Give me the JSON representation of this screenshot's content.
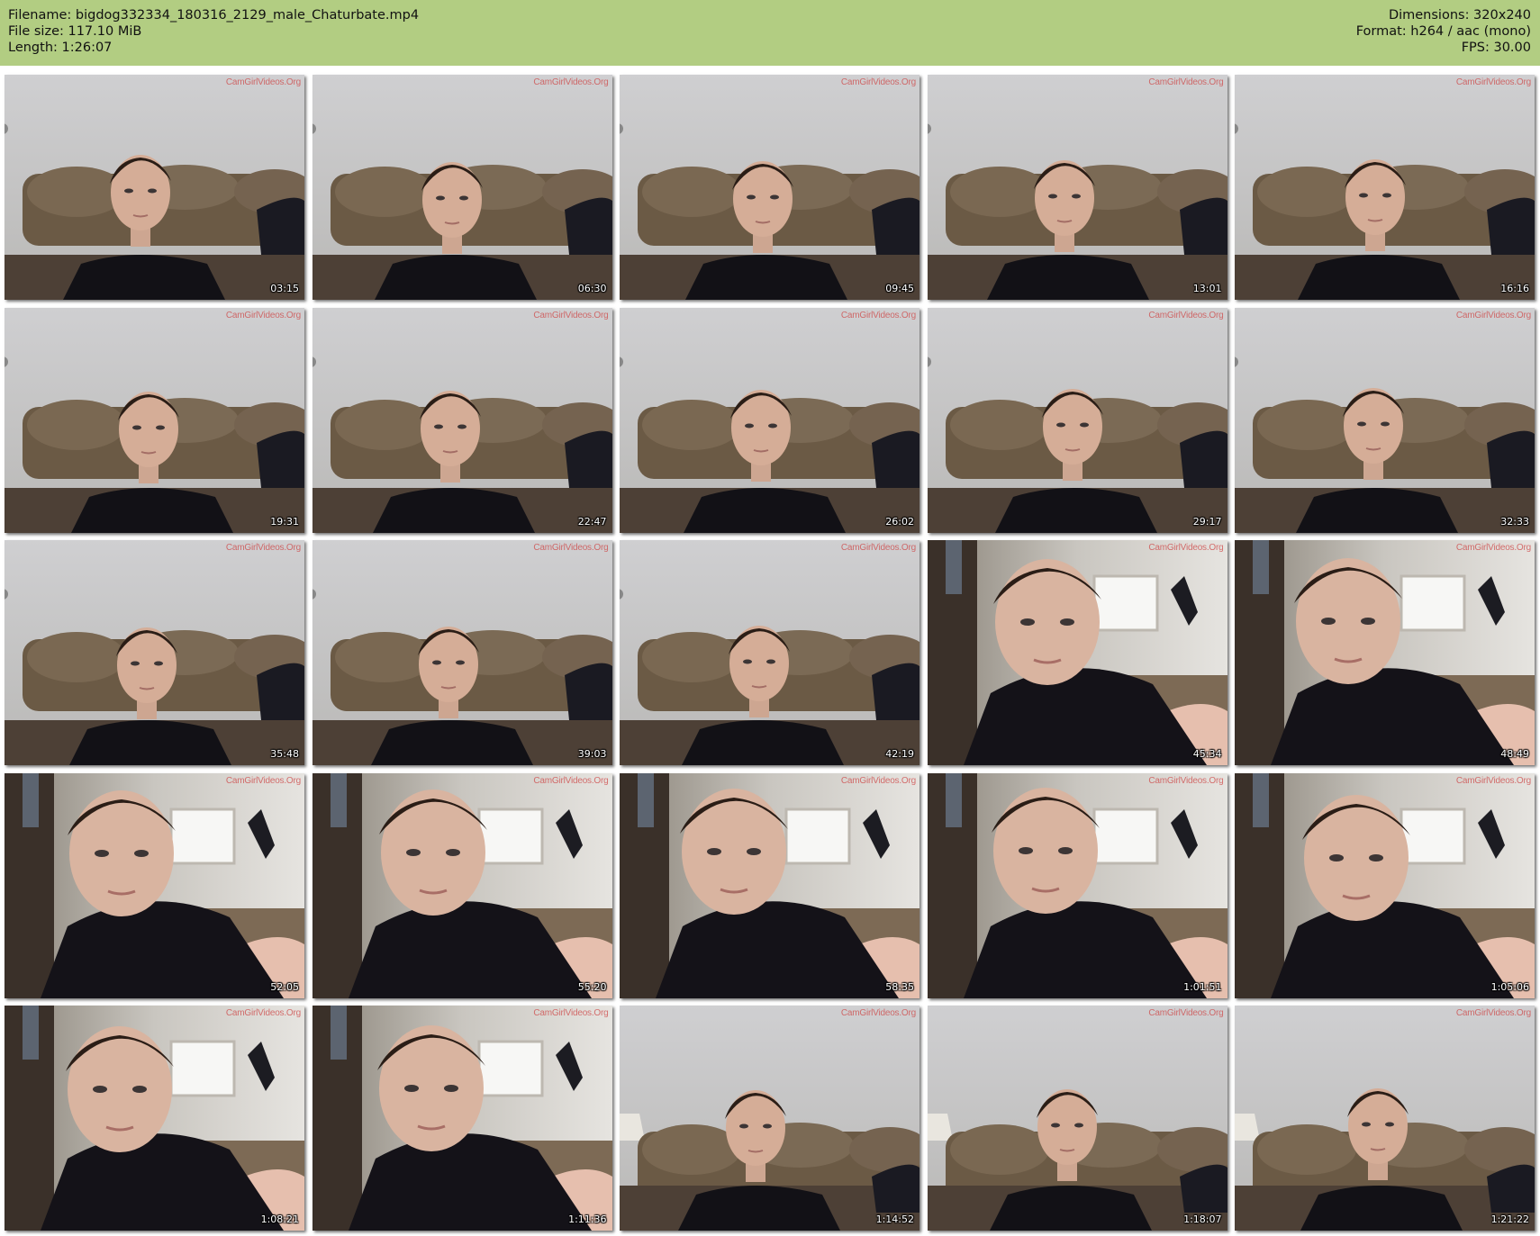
{
  "header": {
    "filename": "Filename: bigdog332334_180316_2129_male_Chaturbate.mp4",
    "filesize": "File size: 117.10 MiB",
    "length": "Length: 1:26:07",
    "dimensions": "Dimensions: 320x240",
    "format": "Format: h264 / aac (mono)",
    "fps": "FPS: 30.00"
  },
  "colors": {
    "header_bg": "#b2cd82",
    "watermark": "#cd4646"
  },
  "thumbnails": [
    {
      "time": "03:15",
      "scene": "couch",
      "watermark": "CamGirlVideos.Org"
    },
    {
      "time": "06:30",
      "scene": "couch",
      "watermark": "CamGirlVideos.Org"
    },
    {
      "time": "09:45",
      "scene": "couch",
      "watermark": "CamGirlVideos.Org"
    },
    {
      "time": "13:01",
      "scene": "couch",
      "watermark": "CamGirlVideos.Org"
    },
    {
      "time": "16:16",
      "scene": "couch",
      "watermark": "CamGirlVideos.Org"
    },
    {
      "time": "19:31",
      "scene": "couch",
      "watermark": "CamGirlVideos.Org"
    },
    {
      "time": "22:47",
      "scene": "couch",
      "watermark": "CamGirlVideos.Org"
    },
    {
      "time": "26:02",
      "scene": "couch",
      "watermark": "CamGirlVideos.Org"
    },
    {
      "time": "29:17",
      "scene": "couch",
      "watermark": "CamGirlVideos.Org"
    },
    {
      "time": "32:33",
      "scene": "couch",
      "watermark": "CamGirlVideos.Org"
    },
    {
      "time": "35:48",
      "scene": "couch",
      "watermark": "CamGirlVideos.Org"
    },
    {
      "time": "39:03",
      "scene": "couch",
      "watermark": "CamGirlVideos.Org"
    },
    {
      "time": "42:19",
      "scene": "couch",
      "watermark": "CamGirlVideos.Org"
    },
    {
      "time": "45:34",
      "scene": "closeup",
      "watermark": "CamGirlVideos.Org"
    },
    {
      "time": "48:49",
      "scene": "closeup",
      "watermark": "CamGirlVideos.Org"
    },
    {
      "time": "52:05",
      "scene": "closeup",
      "watermark": "CamGirlVideos.Org"
    },
    {
      "time": "55:20",
      "scene": "closeup",
      "watermark": "CamGirlVideos.Org"
    },
    {
      "time": "58:35",
      "scene": "closeup",
      "watermark": "CamGirlVideos.Org"
    },
    {
      "time": "1:01:51",
      "scene": "closeup",
      "watermark": "CamGirlVideos.Org"
    },
    {
      "time": "1:05:06",
      "scene": "closeup",
      "watermark": "CamGirlVideos.Org"
    },
    {
      "time": "1:08:21",
      "scene": "closeup",
      "watermark": "CamGirlVideos.Org"
    },
    {
      "time": "1:11:36",
      "scene": "closeup",
      "watermark": "CamGirlVideos.Org"
    },
    {
      "time": "1:14:52",
      "scene": "couch-lamp",
      "watermark": "CamGirlVideos.Org"
    },
    {
      "time": "1:18:07",
      "scene": "couch-lamp",
      "watermark": "CamGirlVideos.Org"
    },
    {
      "time": "1:21:22",
      "scene": "couch-lamp",
      "watermark": "CamGirlVideos.Org"
    }
  ]
}
